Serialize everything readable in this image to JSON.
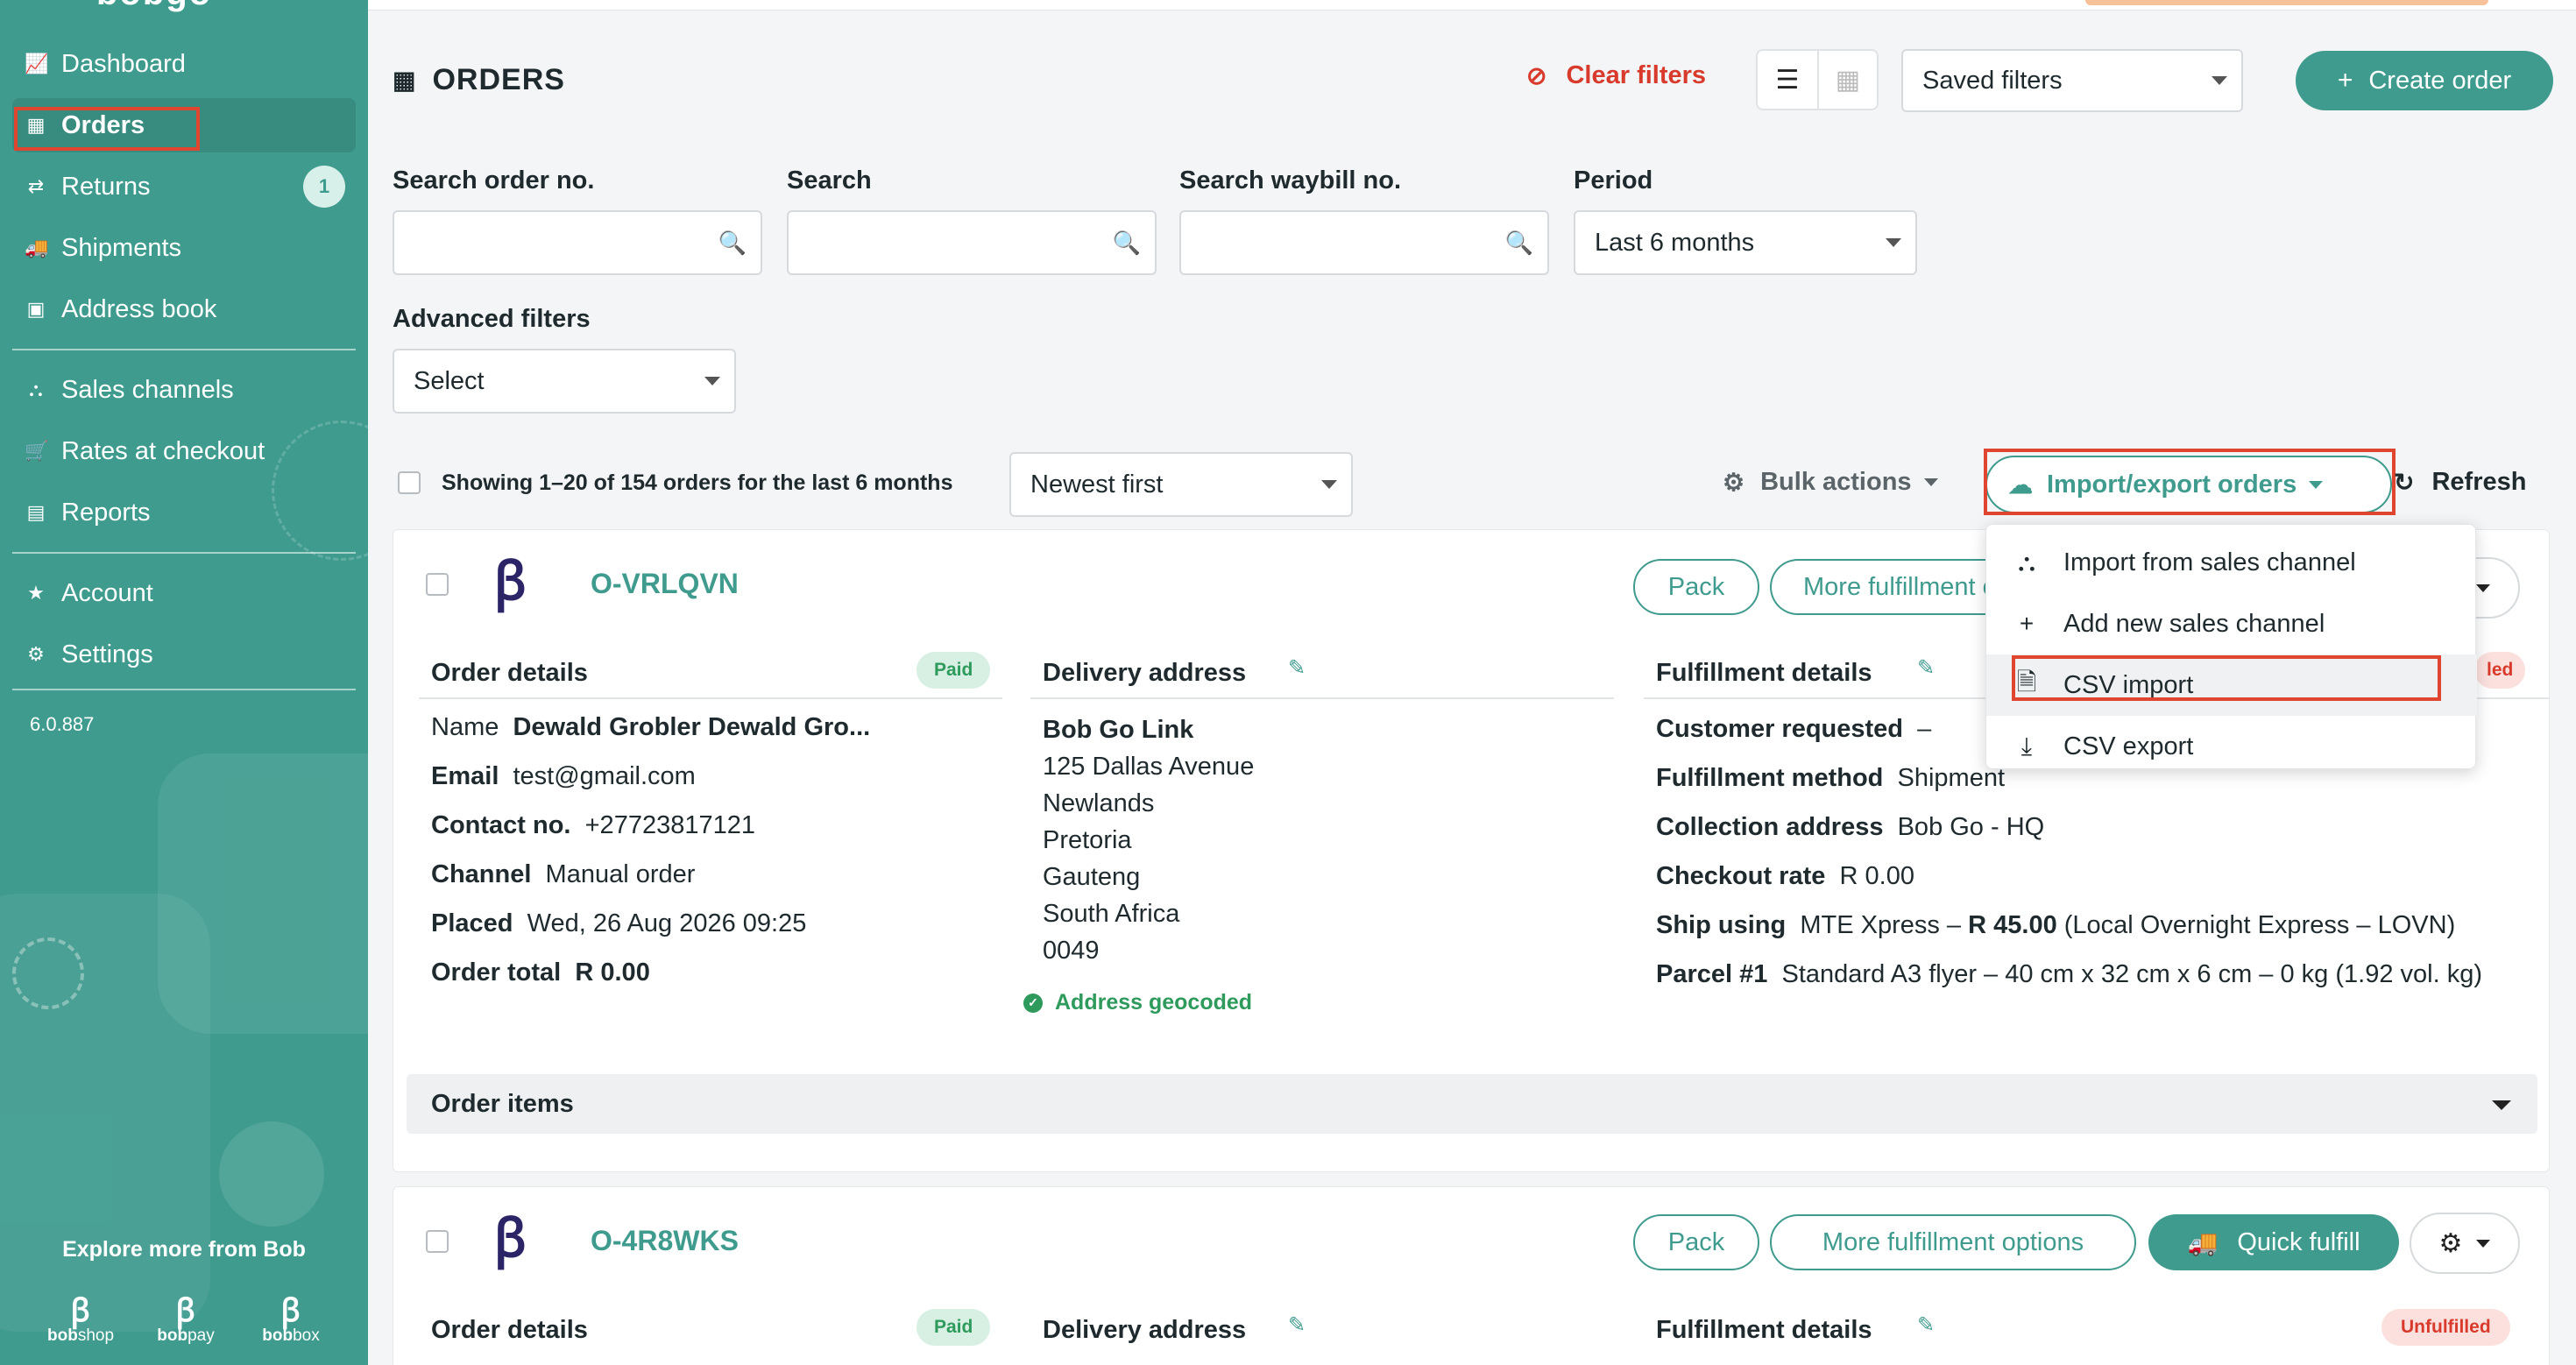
{
  "sidebar": {
    "logo": "bobgo",
    "nav_group1": [
      {
        "label": "Dashboard",
        "icon": "chart-line-icon"
      },
      {
        "label": "Orders",
        "icon": "calendar-icon"
      },
      {
        "label": "Returns",
        "icon": "arrows-exchange-icon",
        "badge": "1"
      },
      {
        "label": "Shipments",
        "icon": "truck-icon"
      },
      {
        "label": "Address book",
        "icon": "address-book-icon"
      }
    ],
    "nav_group2": [
      {
        "label": "Sales channels",
        "icon": "sitemap-icon"
      },
      {
        "label": "Rates at checkout",
        "icon": "cart-icon"
      },
      {
        "label": "Reports",
        "icon": "report-icon"
      }
    ],
    "nav_group3": [
      {
        "label": "Account",
        "icon": "star-icon"
      },
      {
        "label": "Settings",
        "icon": "gear-icon"
      }
    ],
    "version": "6.0.887",
    "explore": "Explore more from Bob",
    "brands": [
      {
        "name_prefix": "bob",
        "name_suffix": "shop"
      },
      {
        "name_prefix": "bob",
        "name_suffix": "pay"
      },
      {
        "name_prefix": "bob",
        "name_suffix": "box"
      }
    ]
  },
  "header": {
    "title": "ORDERS",
    "clear_filters": "Clear filters",
    "saved_filters": "Saved filters",
    "create_order": "Create order"
  },
  "filters": {
    "order_no_label": "Search order no.",
    "search_label": "Search",
    "waybill_label": "Search waybill no.",
    "period_label": "Period",
    "period_value": "Last 6 months",
    "advanced_label": "Advanced filters",
    "advanced_value": "Select"
  },
  "toolbar": {
    "showing": "Showing 1–20 of 154 orders for the last 6 months",
    "sort": "Newest first",
    "bulk_actions": "Bulk actions",
    "import_export": "Import/export orders",
    "refresh": "Refresh"
  },
  "dropdown": {
    "items": [
      {
        "label": "Import from sales channel",
        "icon": "sitemap-icon"
      },
      {
        "label": "Add new sales channel",
        "icon": "plus-icon"
      },
      {
        "label": "CSV import",
        "icon": "file-import-icon"
      },
      {
        "label": "CSV export",
        "icon": "download-icon"
      }
    ]
  },
  "orders": [
    {
      "number": "O-VRLQVN",
      "pack": "Pack",
      "more_options": "More fulfillment options",
      "order_details_title": "Order details",
      "payment_status": "Paid",
      "name_label": "Name",
      "name_value": "Dewald Grobler Dewald Gro...",
      "email_label": "Email",
      "email_value": "test@gmail.com",
      "contact_label": "Contact no.",
      "contact_value": "+27723817121",
      "channel_label": "Channel",
      "channel_value": "Manual order",
      "placed_label": "Placed",
      "placed_value": "Wed, 26 Aug 2026 09:25",
      "total_label": "Order total",
      "total_value": "R 0.00",
      "delivery_title": "Delivery address",
      "address_lines": [
        "Bob Go Link",
        "125 Dallas Avenue",
        "Newlands",
        "Pretoria",
        "Gauteng",
        "South Africa",
        "0049"
      ],
      "geocoded": "Address geocoded",
      "fulfillment_title": "Fulfillment details",
      "fulfillment_status_partial": "led",
      "customer_requested_label": "Customer requested",
      "customer_requested_value": "–",
      "method_label": "Fulfillment method",
      "method_value": "Shipment",
      "collection_label": "Collection address",
      "collection_value": "Bob Go - HQ",
      "checkout_rate_label": "Checkout rate",
      "checkout_rate_value": "R 0.00",
      "ship_using_label": "Ship using",
      "ship_using_pre": "MTE Xpress –",
      "ship_using_price": "R 45.00",
      "ship_using_post": "(Local Overnight Express – LOVN)",
      "parcel_label": "Parcel #1",
      "parcel_value": "Standard A3 flyer – 40 cm x 32 cm x 6 cm – 0 kg (1.92 vol. kg)",
      "items_title": "Order items"
    },
    {
      "number": "O-4R8WKS",
      "pack": "Pack",
      "more_options": "More fulfillment options",
      "quick_fulfill": "Quick fulfill",
      "order_details_title": "Order details",
      "payment_status": "Paid",
      "delivery_title": "Delivery address",
      "fulfillment_title": "Fulfillment details",
      "fulfillment_status": "Unfulfilled"
    }
  ]
}
